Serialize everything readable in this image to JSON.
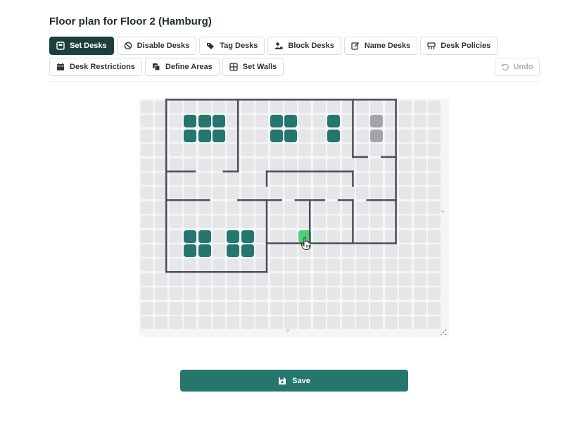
{
  "page": {
    "title": "Floor plan for Floor 2 (Hamburg)"
  },
  "toolbar": {
    "set_desks": "Set Desks",
    "disable_desks": "Disable Desks",
    "tag_desks": "Tag Desks",
    "block_desks": "Block Desks",
    "name_desks": "Name Desks",
    "desk_policies": "Desk Policies",
    "desk_restrictions": "Desk Restrictions",
    "define_areas": "Define Areas",
    "set_walls": "Set Walls",
    "undo": "Undo",
    "active_tool": "Set Desks"
  },
  "floor_plan": {
    "grid_columns": 21,
    "grid_rows": 16,
    "desks": [
      [
        3,
        1
      ],
      [
        4,
        1
      ],
      [
        5,
        1
      ],
      [
        3,
        2
      ],
      [
        4,
        2
      ],
      [
        5,
        2
      ],
      [
        9,
        1
      ],
      [
        10,
        1
      ],
      [
        9,
        2
      ],
      [
        10,
        2
      ],
      [
        13,
        1
      ],
      [
        13,
        2
      ],
      [
        3,
        9
      ],
      [
        4,
        9
      ],
      [
        3,
        10
      ],
      [
        4,
        10
      ],
      [
        6,
        9
      ],
      [
        7,
        9
      ],
      [
        6,
        10
      ],
      [
        7,
        10
      ]
    ],
    "disabled_desks": [
      [
        16,
        1
      ],
      [
        16,
        2
      ]
    ],
    "hovered_desk": [
      11,
      9
    ],
    "walls": [
      [
        [
          1.75,
          -0.1
        ],
        [
          17.75,
          -0.1
        ]
      ],
      [
        [
          1.75,
          -0.1
        ],
        [
          1.75,
          11.9
        ]
      ],
      [
        [
          1.75,
          11.9
        ],
        [
          8.75,
          11.9
        ]
      ],
      [
        [
          8.75,
          6.9
        ],
        [
          8.75,
          11.9
        ]
      ],
      [
        [
          17.75,
          -0.1
        ],
        [
          17.75,
          9.9
        ]
      ],
      [
        [
          8.75,
          9.9
        ],
        [
          17.75,
          9.9
        ]
      ],
      [
        [
          6.75,
          -0.1
        ],
        [
          6.75,
          4.9
        ]
      ],
      [
        [
          14.75,
          -0.1
        ],
        [
          14.75,
          3.9
        ]
      ],
      [
        [
          14.75,
          3.9
        ],
        [
          15.75,
          3.9
        ]
      ],
      [
        [
          16.75,
          3.9
        ],
        [
          17.75,
          3.9
        ]
      ],
      [
        [
          1.75,
          4.9
        ],
        [
          3.75,
          4.9
        ]
      ],
      [
        [
          5.75,
          4.9
        ],
        [
          6.75,
          4.9
        ]
      ],
      [
        [
          8.75,
          4.9
        ],
        [
          14.75,
          4.9
        ]
      ],
      [
        [
          8.75,
          4.9
        ],
        [
          8.75,
          5.9
        ]
      ],
      [
        [
          14.75,
          4.9
        ],
        [
          14.75,
          5.9
        ]
      ],
      [
        [
          1.75,
          6.9
        ],
        [
          4.75,
          6.9
        ]
      ],
      [
        [
          6.75,
          6.9
        ],
        [
          9.75,
          6.9
        ]
      ],
      [
        [
          10.75,
          6.9
        ],
        [
          12.75,
          6.9
        ]
      ],
      [
        [
          13.75,
          6.9
        ],
        [
          14.75,
          6.9
        ]
      ],
      [
        [
          15.75,
          6.9
        ],
        [
          17.75,
          6.9
        ]
      ],
      [
        [
          11.75,
          6.9
        ],
        [
          11.75,
          9.9
        ]
      ],
      [
        [
          14.75,
          6.9
        ],
        [
          14.75,
          9.9
        ]
      ]
    ]
  },
  "footer": {
    "save": "Save"
  },
  "colors": {
    "accent": "#25776e",
    "active_button": "#1d3f3c",
    "desk": "#25776e",
    "desk_disabled": "#a2a5a8",
    "desk_hover": "#4cd07a",
    "cell": "#e5e6e8",
    "wall": "#4b5058"
  },
  "icons": {
    "set_desks": "desk-square-icon",
    "disable_desks": "ban-icon",
    "tag_desks": "tag-icon",
    "block_desks": "user-lock-icon",
    "name_desks": "edit-icon",
    "desk_policies": "policy-icon",
    "desk_restrictions": "calendar-icon",
    "define_areas": "layers-icon",
    "set_walls": "grid-icon",
    "undo": "undo-icon",
    "save": "floppy-disk-icon"
  }
}
